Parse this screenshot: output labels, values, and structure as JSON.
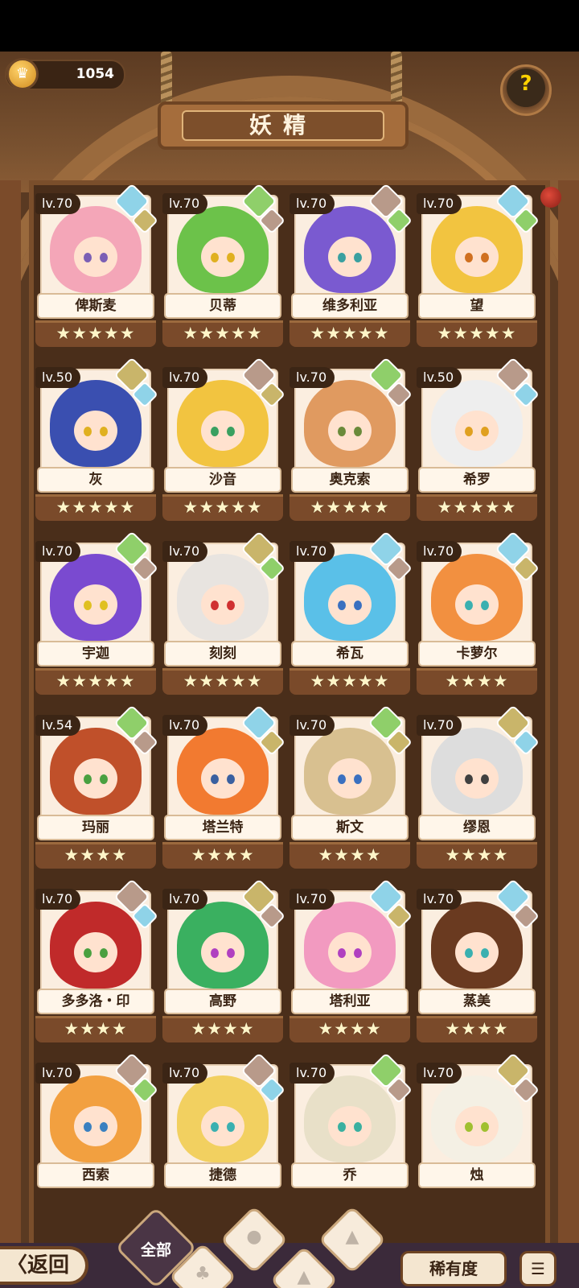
{
  "header": {
    "currency_value": "1054",
    "currency_icon": "crown-coin-icon",
    "title": "妖精",
    "help_icon": "question-sprout-icon"
  },
  "colors": {
    "water": "#8fd3e8",
    "plant": "#8fcf6a",
    "earth": "#c9b56a",
    "rock": "#b89a8a"
  },
  "fairies": [
    {
      "name": "俾斯麦",
      "level": "lv.70",
      "stars": "★★★★★",
      "e1": "water",
      "e2": "earth",
      "hair": "#f4a6b8",
      "eye": "#7b5fb5"
    },
    {
      "name": "贝蒂",
      "level": "lv.70",
      "stars": "★★★★★",
      "e1": "plant",
      "e2": "rock",
      "hair": "#6cc24a",
      "eye": "#e0b020"
    },
    {
      "name": "维多利亚",
      "level": "lv.70",
      "stars": "★★★★★",
      "e1": "rock",
      "e2": "plant",
      "hair": "#7a5ad0",
      "eye": "#3aa0a0"
    },
    {
      "name": "望",
      "level": "lv.70",
      "stars": "★★★★★",
      "e1": "water",
      "e2": "plant",
      "hair": "#f2c440",
      "eye": "#d07020"
    },
    {
      "name": "灰",
      "level": "lv.50",
      "stars": "★★★★★",
      "e1": "earth",
      "e2": "water",
      "hair": "#3a4fb0",
      "eye": "#e0b020"
    },
    {
      "name": "沙音",
      "level": "lv.70",
      "stars": "★★★★★",
      "e1": "rock",
      "e2": "earth",
      "hair": "#f2c440",
      "eye": "#3aa060"
    },
    {
      "name": "奥克索",
      "level": "lv.70",
      "stars": "★★★★★",
      "e1": "plant",
      "e2": "rock",
      "hair": "#e09a60",
      "eye": "#6a8a3a"
    },
    {
      "name": "希罗",
      "level": "lv.50",
      "stars": "★★★★★",
      "e1": "rock",
      "e2": "water",
      "hair": "#eeeeee",
      "eye": "#e0a020"
    },
    {
      "name": "宇迦",
      "level": "lv.70",
      "stars": "★★★★★",
      "e1": "plant",
      "e2": "rock",
      "hair": "#7a4ad0",
      "eye": "#e0c020"
    },
    {
      "name": "刻刻",
      "level": "lv.70",
      "stars": "★★★★★",
      "e1": "earth",
      "e2": "plant",
      "hair": "#e8e4e0",
      "eye": "#d03030"
    },
    {
      "name": "希瓦",
      "level": "lv.70",
      "stars": "★★★★★",
      "e1": "water",
      "e2": "rock",
      "hair": "#5ac0e8",
      "eye": "#3a70c0"
    },
    {
      "name": "卡萝尔",
      "level": "lv.70",
      "stars": "★★★★",
      "e1": "water",
      "e2": "earth",
      "hair": "#f29040",
      "eye": "#3ab0b0"
    },
    {
      "name": "玛丽",
      "level": "lv.54",
      "stars": "★★★★",
      "e1": "plant",
      "e2": "rock",
      "hair": "#c0502a",
      "eye": "#4aa040"
    },
    {
      "name": "塔兰特",
      "level": "lv.70",
      "stars": "★★★★",
      "e1": "water",
      "e2": "earth",
      "hair": "#f27a30",
      "eye": "#3a60a0"
    },
    {
      "name": "斯文",
      "level": "lv.70",
      "stars": "★★★★",
      "e1": "plant",
      "e2": "earth",
      "hair": "#d8c090",
      "eye": "#3a70c0"
    },
    {
      "name": "缪恩",
      "level": "lv.70",
      "stars": "★★★★",
      "e1": "earth",
      "e2": "water",
      "hair": "#dddddd",
      "eye": "#404040"
    },
    {
      "name": "多多洛・印",
      "level": "lv.70",
      "stars": "★★★★",
      "e1": "rock",
      "e2": "water",
      "hair": "#c02a2a",
      "eye": "#4aa040"
    },
    {
      "name": "高野",
      "level": "lv.70",
      "stars": "★★★★",
      "e1": "earth",
      "e2": "rock",
      "hair": "#3ab060",
      "eye": "#b040c0"
    },
    {
      "name": "塔利亚",
      "level": "lv.70",
      "stars": "★★★★",
      "e1": "water",
      "e2": "earth",
      "hair": "#f29ac0",
      "eye": "#b040c0"
    },
    {
      "name": "蒸美",
      "level": "lv.70",
      "stars": "★★★★",
      "e1": "water",
      "e2": "rock",
      "hair": "#6a3a20",
      "eye": "#3ab0b0"
    },
    {
      "name": "西索",
      "level": "lv.70",
      "stars": "",
      "e1": "rock",
      "e2": "plant",
      "hair": "#f2a040",
      "eye": "#3a80c0"
    },
    {
      "name": "捷德",
      "level": "lv.70",
      "stars": "",
      "e1": "rock",
      "e2": "water",
      "hair": "#f2d060",
      "eye": "#3ab0b0"
    },
    {
      "name": "乔",
      "level": "lv.70",
      "stars": "",
      "e1": "plant",
      "e2": "rock",
      "hair": "#e8e0c8",
      "eye": "#3ab0a0"
    },
    {
      "name": "烛",
      "level": "lv.70",
      "stars": "",
      "e1": "earth",
      "e2": "rock",
      "hair": "#f4f0e4",
      "eye": "#a0c030"
    }
  ],
  "bottom": {
    "back_label": "〈返回",
    "filter_all_label": "全部",
    "rarity_label": "稀有度",
    "sort_icon": "sort-list-icon"
  }
}
